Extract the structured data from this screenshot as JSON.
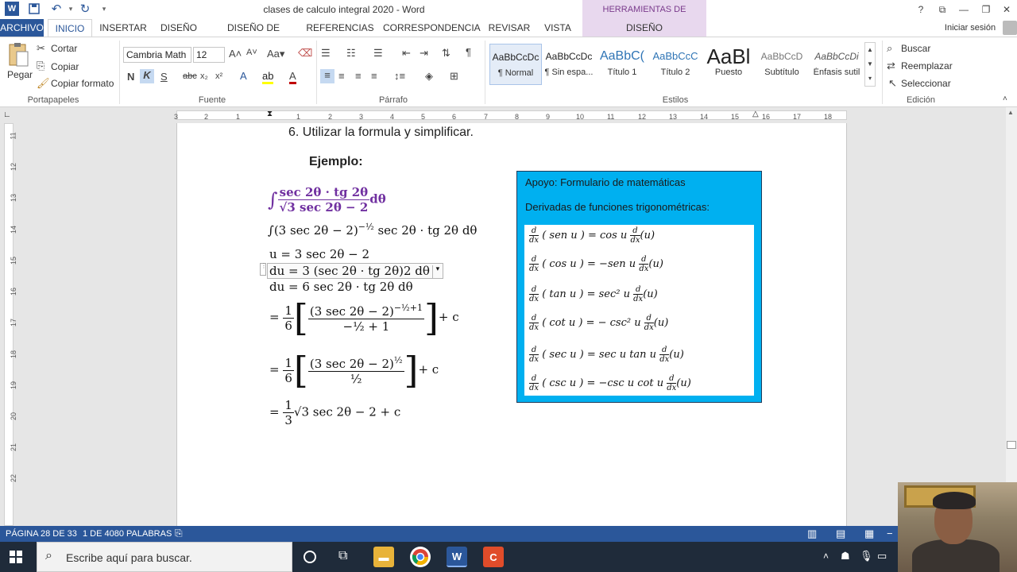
{
  "window": {
    "title": "clases de calculo integral 2020 - Word",
    "context_group": "HERRAMIENTAS DE ECUACIÓN",
    "help": "?",
    "signin": "Iniciar sesión"
  },
  "tabs": [
    "ARCHIVO",
    "INICIO",
    "INSERTAR",
    "DISEÑO",
    "DISEÑO DE PÁGINA",
    "REFERENCIAS",
    "CORRESPONDENCIA",
    "REVISAR",
    "VISTA",
    "DISEÑO"
  ],
  "ribbon": {
    "clipboard": {
      "paste": "Pegar",
      "cut": "Cortar",
      "copy": "Copiar",
      "format_painter": "Copiar formato",
      "label": "Portapapeles"
    },
    "font": {
      "name": "Cambria Math",
      "size": "12",
      "label": "Fuente"
    },
    "paragraph": {
      "label": "Párrafo"
    },
    "styles": {
      "label": "Estilos",
      "items": [
        {
          "preview": "AaBbCcDc",
          "name": "¶ Normal"
        },
        {
          "preview": "AaBbCcDc",
          "name": "¶ Sin espa..."
        },
        {
          "preview": "AaBbC(",
          "name": "Título 1"
        },
        {
          "preview": "AaBbCcC",
          "name": "Título 2"
        },
        {
          "preview": "AaBl",
          "name": "Puesto"
        },
        {
          "preview": "AaBbCcD",
          "name": "Subtítulo"
        },
        {
          "preview": "AaBbCcDi",
          "name": "Énfasis sutil"
        }
      ]
    },
    "editing": {
      "find": "Buscar",
      "replace": "Reemplazar",
      "select": "Seleccionar",
      "label": "Edición"
    }
  },
  "ruler": {
    "numbers": [
      "3",
      "2",
      "1",
      "1",
      "2",
      "3",
      "4",
      "5",
      "6",
      "7",
      "8",
      "9",
      "10",
      "11",
      "12",
      "13",
      "14",
      "15",
      "16",
      "17",
      "18"
    ],
    "left_numbers": [
      "11",
      "12",
      "13",
      "14",
      "15",
      "16",
      "17",
      "18",
      "19",
      "20",
      "21",
      "22"
    ]
  },
  "document": {
    "step": "6.   Utilizar la formula y simplificar.",
    "example_heading": "Ejemplo:",
    "math": {
      "integral_num": "sec 2θ · tg 2θ",
      "integral_den": "√3 sec 2θ − 2",
      "integral_tail": "dθ",
      "line2": "∫(3 sec 2θ − 2)",
      "line2_exp": "−½",
      "line2_tail": " sec 2θ · tg 2θ  dθ",
      "u_line": "u = 3 sec 2θ − 2",
      "du_line": "du = 3 (sec 2θ · tg 2θ)2 dθ",
      "du_line2": "du = 6  sec 2θ · tg 2θ  dθ",
      "eq": "=",
      "one": "1",
      "six": "6",
      "three": "3",
      "step1_num": "(3 sec 2θ − 2)",
      "step1_exp": "−½+1",
      "step1_den": "−½ + 1",
      "step2_num": "(3 sec 2θ − 2)",
      "step2_exp": "½",
      "step2_den": "½",
      "plus_c": "+ c",
      "final_root": "√3 sec 2θ − 2 + c"
    },
    "infobox": {
      "title": "Apoyo: Formulario de matemáticas",
      "subtitle": "Derivadas de funciones trigonométricas:",
      "d": "d",
      "dx": "dx",
      "formulas": [
        {
          "lhs": "( sen u ) =",
          "rhs": "cos u",
          "tail": "(u)"
        },
        {
          "lhs": "( cos u ) =",
          "rhs": "−sen u",
          "tail": "(u)"
        },
        {
          "lhs": "( tan u ) =",
          "rhs": "sec² u",
          "tail": "(u)"
        },
        {
          "lhs": "( cot u ) =",
          "rhs": "− csc² u",
          "tail": "(u)"
        },
        {
          "lhs": "( sec u ) =",
          "rhs": "sec u tan u",
          "tail": "(u)"
        },
        {
          "lhs": "( csc u ) =",
          "rhs": "−csc u cot u",
          "tail": "(u)"
        }
      ]
    }
  },
  "statusbar": {
    "page": "PÁGINA 28 DE 33",
    "words": "1 DE 4080 PALABRAS"
  },
  "taskbar": {
    "search_placeholder": "Escribe aquí para buscar."
  }
}
